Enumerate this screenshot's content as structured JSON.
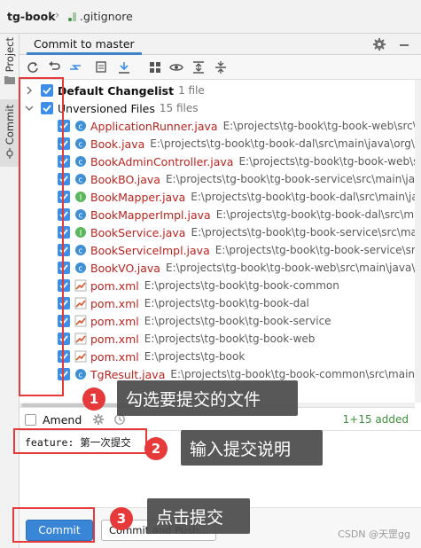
{
  "breadcrumb": {
    "project": "tg-book",
    "separator": "›",
    "file": ".gitignore"
  },
  "side_tabs": {
    "project": "Project",
    "commit": "Commit"
  },
  "panel": {
    "tab_label": "Commit to master"
  },
  "icons": {
    "toolbar": [
      "refresh-icon",
      "rollback-icon",
      "diff-icon",
      "shelve-icon",
      "update-icon",
      "group-by-icon",
      "view-options-icon",
      "expand-all-icon",
      "collapse-all-icon"
    ],
    "head": [
      "gear-icon",
      "minimize-icon"
    ]
  },
  "changelists": [
    {
      "title": "Default Changelist",
      "count": "1 file",
      "expanded": false
    },
    {
      "title": "Unversioned Files",
      "count": "15 files",
      "expanded": true
    }
  ],
  "files": [
    {
      "name": "ApplicationRunner.java",
      "path": "E:\\projects\\tg-book\\tg-book-web\\src\\main\\java\\",
      "icon": "java-class-icon"
    },
    {
      "name": "Book.java",
      "path": "E:\\projects\\tg-book\\tg-book-dal\\src\\main\\java\\org\\",
      "icon": "java-class-icon"
    },
    {
      "name": "BookAdminController.java",
      "path": "E:\\projects\\tg-book\\tg-book-web\\src\\main\\",
      "icon": "java-class-icon"
    },
    {
      "name": "BookBO.java",
      "path": "E:\\projects\\tg-book\\tg-book-service\\src\\main\\java\\",
      "icon": "java-class-icon"
    },
    {
      "name": "BookMapper.java",
      "path": "E:\\projects\\tg-book\\tg-book-dal\\src\\main\\java\\",
      "icon": "java-interface-icon"
    },
    {
      "name": "BookMapperImpl.java",
      "path": "E:\\projects\\tg-book\\tg-book-dal\\src\\main\\java\\",
      "icon": "java-class-icon"
    },
    {
      "name": "BookService.java",
      "path": "E:\\projects\\tg-book\\tg-book-service\\src\\main\\",
      "icon": "java-interface-icon"
    },
    {
      "name": "BookServiceImpl.java",
      "path": "E:\\projects\\tg-book\\tg-book-service\\src\\main\\",
      "icon": "java-class-icon"
    },
    {
      "name": "BookVO.java",
      "path": "E:\\projects\\tg-book\\tg-book-web\\src\\main\\java\\",
      "icon": "java-class-icon"
    },
    {
      "name": "pom.xml",
      "path": "E:\\projects\\tg-book\\tg-book-common",
      "icon": "maven-icon"
    },
    {
      "name": "pom.xml",
      "path": "E:\\projects\\tg-book\\tg-book-dal",
      "icon": "maven-icon"
    },
    {
      "name": "pom.xml",
      "path": "E:\\projects\\tg-book\\tg-book-service",
      "icon": "maven-icon"
    },
    {
      "name": "pom.xml",
      "path": "E:\\projects\\tg-book\\tg-book-web",
      "icon": "maven-icon"
    },
    {
      "name": "pom.xml",
      "path": "E:\\projects\\tg-book",
      "icon": "maven-icon"
    },
    {
      "name": "TgResult.java",
      "path": "E:\\projects\\tg-book\\tg-book-common\\src\\main\\",
      "icon": "java-class-icon"
    }
  ],
  "amend": {
    "label": "Amend",
    "checked": false
  },
  "status": {
    "added": "1+15 added"
  },
  "message": {
    "value": "feature: 第一次提交"
  },
  "buttons": {
    "commit": "Commit",
    "commit_push": "Commit and Push..."
  },
  "annotations": [
    {
      "number": "1",
      "text": "勾选要提交的文件"
    },
    {
      "number": "2",
      "text": "输入提交说明"
    },
    {
      "number": "3",
      "text": "点击提交"
    }
  ],
  "watermark": "CSDN @天罡gg",
  "colors": {
    "accent": "#3a86d6",
    "checkbox": "#3c8ee8",
    "filename": "#b8241e",
    "added": "#3d8f3d",
    "highlight": "#e6393a"
  }
}
